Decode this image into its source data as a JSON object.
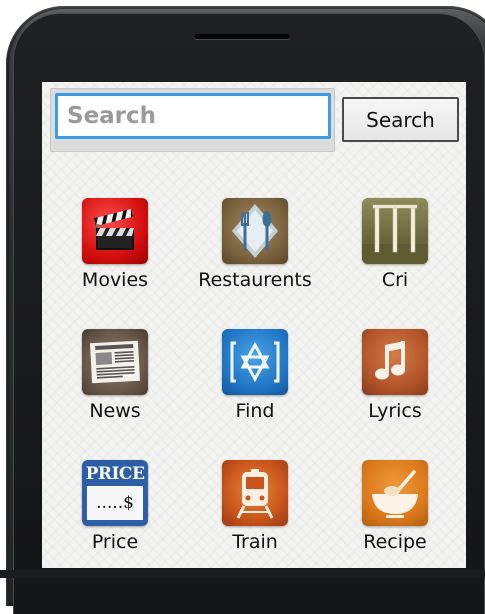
{
  "search": {
    "placeholder": "Search",
    "button_label": "Search"
  },
  "apps": [
    {
      "label": "Movies",
      "icon": "clapperboard-icon"
    },
    {
      "label": "Restaurents",
      "icon": "cutlery-icon"
    },
    {
      "label": "Cri",
      "icon": "cricket-wicket-icon"
    },
    {
      "label": "News",
      "icon": "newspaper-icon"
    },
    {
      "label": "Find",
      "icon": "find-star-icon"
    },
    {
      "label": "Lyrics",
      "icon": "music-note-icon"
    },
    {
      "label": "Price",
      "icon": "price-tag-icon"
    },
    {
      "label": "Train",
      "icon": "train-icon"
    },
    {
      "label": "Recipe",
      "icon": "mixing-bowl-icon"
    }
  ],
  "price_icon": {
    "word": "PRICE",
    "amount": ".....$"
  },
  "colors": {
    "search_border": "#3d9de3",
    "screen_bg": "#f3f3f1",
    "phone_body": "#2b2c2e"
  }
}
